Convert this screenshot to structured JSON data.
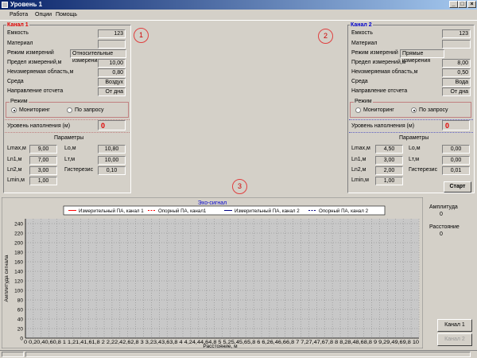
{
  "window": {
    "title": "Уровень 1",
    "icon": "app-icon"
  },
  "menu": [
    "Работа",
    "Опции",
    "Помощь"
  ],
  "markers": [
    "1",
    "2",
    "3"
  ],
  "channel1": {
    "title": "Канал 1",
    "fields": [
      {
        "label": "Емкость",
        "value": "123"
      },
      {
        "label": "Материал",
        "value": ""
      },
      {
        "label": "Режим измерений",
        "value": "Относительные измерения"
      },
      {
        "label": "Предел измерений,м",
        "value": "10,00"
      },
      {
        "label": "Неизмеряемая область,м",
        "value": "0,80"
      },
      {
        "label": "Среда",
        "value": "Воздух"
      },
      {
        "label": "Направление отсчета",
        "value": "От дна"
      }
    ],
    "mode": {
      "title": "Режим",
      "options": [
        "Мониторинг",
        "По запросу"
      ],
      "selected": 0
    },
    "level_label": "Уровень наполнения (м)",
    "level_value": "0",
    "params_title": "Параметры",
    "params": [
      {
        "label": "Lmax,м",
        "value": "9,00"
      },
      {
        "label": "Lo,м",
        "value": "10,80"
      },
      {
        "label": "Ln1,м",
        "value": "7,00"
      },
      {
        "label": "Lт,м",
        "value": "10,00"
      },
      {
        "label": "Ln2,м",
        "value": "3,00"
      },
      {
        "label": "Гистерезис",
        "value": "0,10"
      },
      {
        "label": "Lmin,м",
        "value": "1,00"
      }
    ]
  },
  "channel2": {
    "title": "Канал 2",
    "fields": [
      {
        "label": "Емкость",
        "value": "123"
      },
      {
        "label": "Материал",
        "value": ""
      },
      {
        "label": "Режим измерений",
        "value": "Прямые измерения"
      },
      {
        "label": "Предел измерений,м",
        "value": "8,00"
      },
      {
        "label": "Неизмеряемая область,м",
        "value": "0,50"
      },
      {
        "label": "Среда",
        "value": "Вода"
      },
      {
        "label": "Направление отсчета",
        "value": "От дна"
      }
    ],
    "mode": {
      "title": "Режим",
      "options": [
        "Мониторинг",
        "По запросу"
      ],
      "selected": 1
    },
    "level_label": "Уровень наполнения (м)",
    "level_value": "0",
    "params_title": "Параметры",
    "params": [
      {
        "label": "Lmax,м",
        "value": "4,50"
      },
      {
        "label": "Lo,м",
        "value": "0,00"
      },
      {
        "label": "Ln1,м",
        "value": "3,00"
      },
      {
        "label": "Lт,м",
        "value": "0,00"
      },
      {
        "label": "Ln2,м",
        "value": "2,00"
      },
      {
        "label": "Гистерезис",
        "value": "0,01"
      },
      {
        "label": "Lmin,м",
        "value": "1,00"
      }
    ]
  },
  "start_button": "Старт",
  "side_info": {
    "amp_label": "Амплитуда",
    "amp_value": "0",
    "dist_label": "Расстояние",
    "dist_value": "0"
  },
  "buttons": {
    "channel1": "Канал 1",
    "channel2": "Канал 2"
  },
  "colors": {
    "ch1": "#ff0000",
    "ch2": "#000080",
    "accent_red": "#e00000",
    "title_blue": "#0000cc"
  },
  "chart_data": {
    "type": "line",
    "title": "Эхо-сигнал",
    "xlabel": "Расстояние, м",
    "ylabel": "Амплитуда сигнала",
    "ylim": [
      0,
      250
    ],
    "xlim": [
      0,
      10
    ],
    "y_ticks": [
      0,
      20,
      40,
      60,
      80,
      100,
      120,
      140,
      160,
      180,
      200,
      220,
      240
    ],
    "x_tick_text": "0 0,20,40,60,8 1 1,21,41,61,8 2 2,22,42,62,8 3 3,23,43,63,8 4 4,24,44,64,8 5 5,25,45,65,8 6 6,26,46,66,8 7 7,27,47,67,8 8 8,28,48,68,8 9 9,29,49,69,8 10",
    "grid": true,
    "legend_position": "top",
    "series": [
      {
        "name": "Измерительный ПА, канал 1",
        "color": "#ff0000",
        "dash": "solid",
        "values": []
      },
      {
        "name": "Опорный ПА, канал1",
        "color": "#ff0000",
        "dash": "dashed",
        "values": []
      },
      {
        "name": "Измерительный ПА, канал 2",
        "color": "#000080",
        "dash": "solid",
        "values": []
      },
      {
        "name": "Опорный ПА, канал 2",
        "color": "#000080",
        "dash": "dashed",
        "values": []
      }
    ]
  }
}
